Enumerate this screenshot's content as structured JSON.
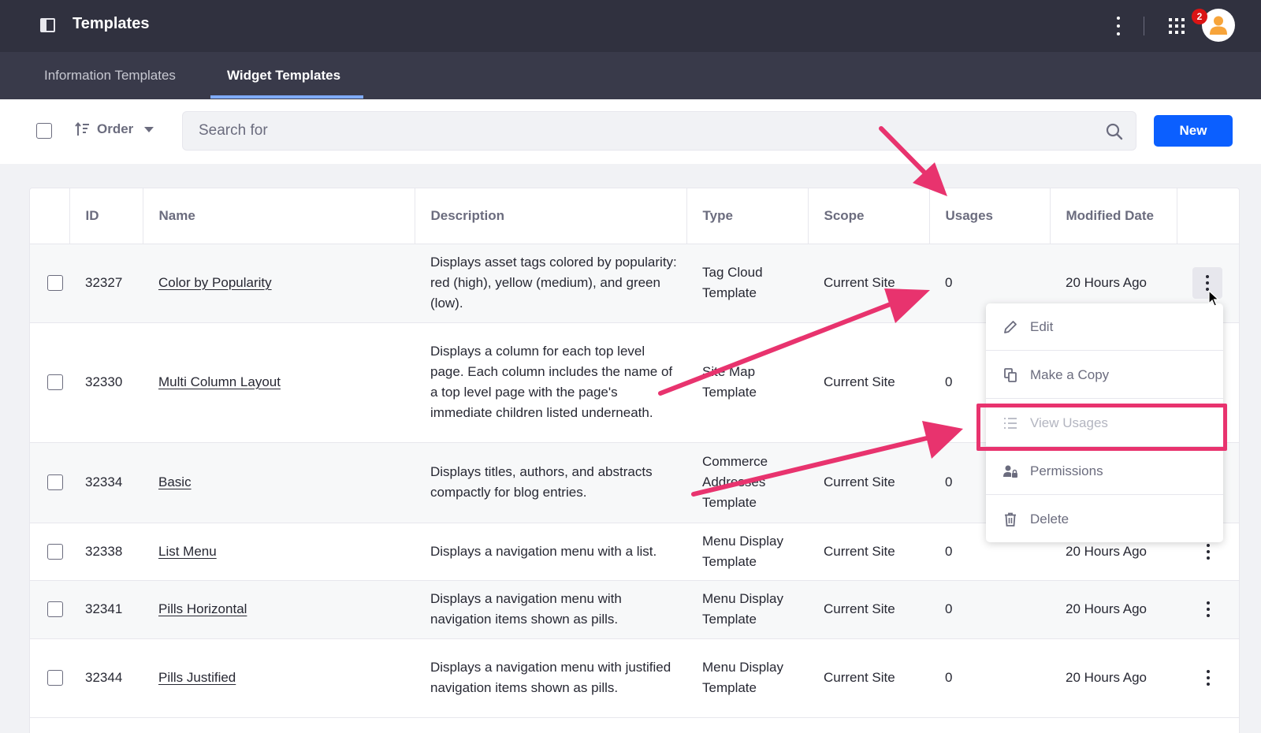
{
  "header": {
    "title": "Templates",
    "notification_count": "2"
  },
  "tabs": [
    {
      "label": "Information Templates",
      "active": false
    },
    {
      "label": "Widget Templates",
      "active": true
    }
  ],
  "toolbar": {
    "order_label": "Order",
    "search_placeholder": "Search for",
    "new_label": "New"
  },
  "table": {
    "columns": [
      "ID",
      "Name",
      "Description",
      "Type",
      "Scope",
      "Usages",
      "Modified Date"
    ],
    "rows": [
      {
        "id": "32327",
        "name": "Color by Popularity",
        "description": "Displays asset tags colored by popularity: red (high), yellow (medium), and green (low).",
        "type": "Tag Cloud Template",
        "scope": "Current Site",
        "usages": "0",
        "modified": "20 Hours Ago"
      },
      {
        "id": "32330",
        "name": "Multi Column Layout",
        "description": "Displays a column for each top level page. Each column includes the name of a top level page with the page's immediate children listed underneath.",
        "type": "Site Map Template",
        "scope": "Current Site",
        "usages": "0",
        "modified": ""
      },
      {
        "id": "32334",
        "name": "Basic",
        "description": "Displays titles, authors, and abstracts compactly for blog entries.",
        "type": "Commerce Addresses Template",
        "scope": "Current Site",
        "usages": "0",
        "modified": ""
      },
      {
        "id": "32338",
        "name": "List Menu",
        "description": "Displays a navigation menu with a list.",
        "type": "Menu Display Template",
        "scope": "Current Site",
        "usages": "0",
        "modified": "20 Hours Ago"
      },
      {
        "id": "32341",
        "name": "Pills Horizontal",
        "description": "Displays a navigation menu with navigation items shown as pills.",
        "type": "Menu Display Template",
        "scope": "Current Site",
        "usages": "0",
        "modified": "20 Hours Ago"
      },
      {
        "id": "32344",
        "name": "Pills Justified",
        "description": "Displays a navigation menu with justified navigation items shown as pills.",
        "type": "Menu Display Template",
        "scope": "Current Site",
        "usages": "0",
        "modified": "20 Hours Ago"
      }
    ]
  },
  "dropdown": {
    "items": [
      {
        "label": "Edit",
        "icon": "pencil-icon",
        "disabled": false
      },
      {
        "label": "Make a Copy",
        "icon": "copy-icon",
        "disabled": false
      },
      {
        "label": "View Usages",
        "icon": "list-icon",
        "disabled": true
      },
      {
        "label": "Permissions",
        "icon": "permissions-icon",
        "disabled": false
      },
      {
        "label": "Delete",
        "icon": "trash-icon",
        "disabled": false
      }
    ]
  },
  "colors": {
    "topbar": "#30313f",
    "tabbar": "#393a4a",
    "primary": "#0b5fff",
    "annotation": "#e8336e",
    "badge": "#da1414"
  }
}
